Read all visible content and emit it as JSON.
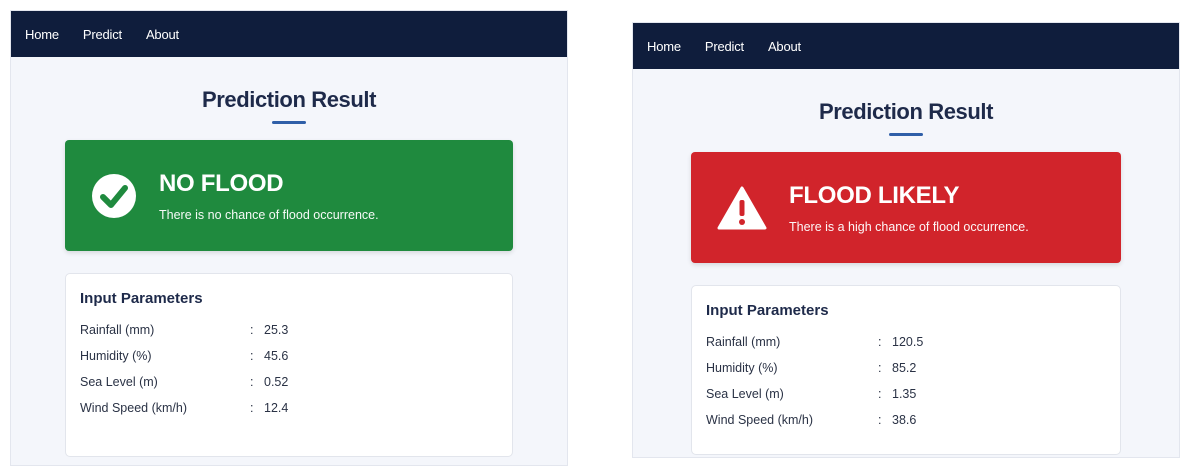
{
  "panels": [
    {
      "nav": [
        "Home",
        "Predict",
        "About"
      ],
      "title": "Prediction Result",
      "result": {
        "status": "safe",
        "icon": "check-circle-icon",
        "heading": "NO FLOOD",
        "description": "There is no chance of flood occurrence.",
        "color": "#1f8a3e"
      },
      "params": {
        "heading": "Input Parameters",
        "rows": [
          {
            "label": "Rainfall (mm)",
            "value": "25.3"
          },
          {
            "label": "Humidity (%)",
            "value": "45.6"
          },
          {
            "label": "Sea Level (m)",
            "value": "0.52"
          },
          {
            "label": "Wind Speed (km/h)",
            "value": "12.4"
          }
        ]
      }
    },
    {
      "nav": [
        "Home",
        "Predict",
        "About"
      ],
      "title": "Prediction Result",
      "result": {
        "status": "danger",
        "icon": "warning-triangle-icon",
        "heading": "FLOOD LIKELY",
        "description": "There is a high chance of flood occurrence.",
        "color": "#d1242b"
      },
      "params": {
        "heading": "Input Parameters",
        "rows": [
          {
            "label": "Rainfall (mm)",
            "value": "120.5"
          },
          {
            "label": "Humidity (%)",
            "value": "85.2"
          },
          {
            "label": "Sea Level (m)",
            "value": "1.35"
          },
          {
            "label": "Wind Speed (km/h)",
            "value": "38.6"
          }
        ]
      }
    }
  ]
}
